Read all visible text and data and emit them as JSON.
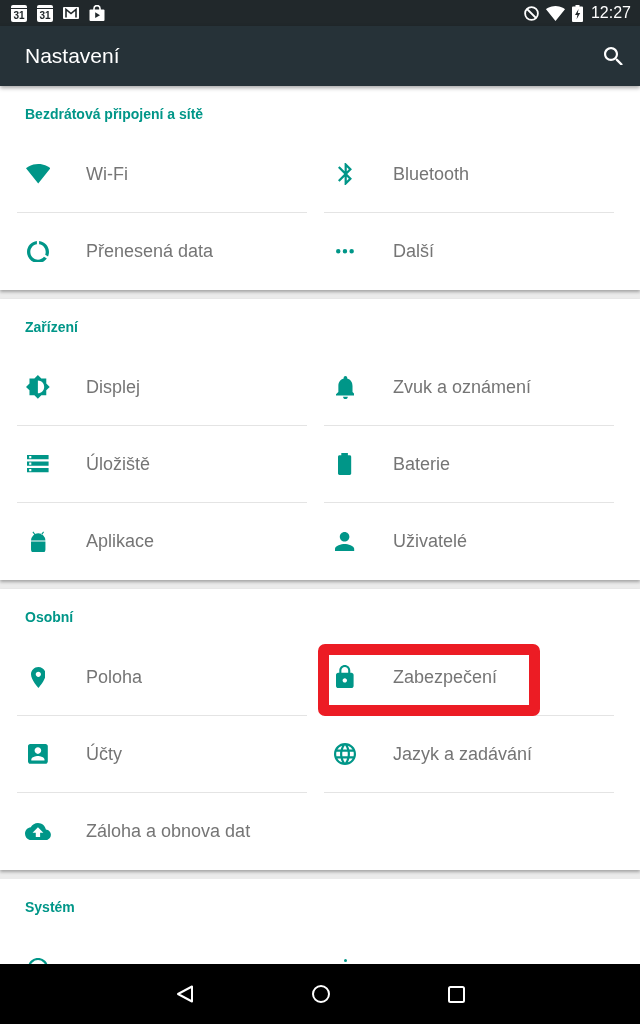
{
  "status_bar": {
    "notifications": [
      {
        "kind": "calendar",
        "label": "31"
      },
      {
        "kind": "calendar",
        "label": "31"
      },
      {
        "kind": "mail"
      },
      {
        "kind": "store"
      }
    ],
    "indicators": [
      {
        "kind": "dnd"
      },
      {
        "kind": "wifi"
      },
      {
        "kind": "battery"
      }
    ],
    "time": "12:27"
  },
  "app_bar": {
    "title": "Nastavení",
    "actions": [
      {
        "kind": "search"
      }
    ]
  },
  "sections": [
    {
      "title": "Bezdrátová připojení a sítě",
      "cut_off": false,
      "items": [
        {
          "label": "Wi-Fi",
          "kind": "wifi",
          "highlighted": false
        },
        {
          "label": "Bluetooth",
          "kind": "bluetooth",
          "highlighted": false
        },
        {
          "label": "Přenesená data",
          "kind": "data",
          "highlighted": false
        },
        {
          "label": "Další",
          "kind": "more",
          "highlighted": false
        }
      ]
    },
    {
      "title": "Zařízení",
      "cut_off": false,
      "items": [
        {
          "label": "Displej",
          "kind": "brightness",
          "highlighted": false
        },
        {
          "label": "Zvuk a oznámení",
          "kind": "bell",
          "highlighted": false
        },
        {
          "label": "Úložiště",
          "kind": "storage",
          "highlighted": false
        },
        {
          "label": "Baterie",
          "kind": "battery",
          "highlighted": false
        },
        {
          "label": "Aplikace",
          "kind": "robot",
          "highlighted": false
        },
        {
          "label": "Uživatelé",
          "kind": "person",
          "highlighted": false
        }
      ]
    },
    {
      "title": "Osobní",
      "cut_off": false,
      "items": [
        {
          "label": "Poloha",
          "kind": "pin",
          "highlighted": false
        },
        {
          "label": "Zabezpečení",
          "kind": "lock",
          "highlighted": true
        },
        {
          "label": "Účty",
          "kind": "account",
          "highlighted": false
        },
        {
          "label": "Jazyk a zadávání",
          "kind": "globe",
          "highlighted": false
        },
        {
          "label": "Záloha a obnova dat",
          "kind": "cloud",
          "highlighted": false
        }
      ]
    },
    {
      "title": "Systém",
      "cut_off": true,
      "items": [
        {
          "kind": "ring",
          "highlighted": false
        },
        {
          "kind": "dot",
          "highlighted": false
        }
      ]
    }
  ],
  "nav_bar": {
    "buttons": [
      {
        "kind": "back"
      },
      {
        "kind": "home"
      },
      {
        "kind": "recents"
      }
    ]
  }
}
